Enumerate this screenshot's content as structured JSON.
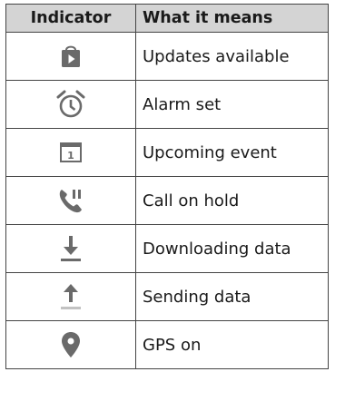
{
  "table": {
    "headers": [
      "Indicator",
      "What it means"
    ],
    "rows": [
      {
        "icon": "play-store-update-icon",
        "text": "Updates available"
      },
      {
        "icon": "alarm-clock-icon",
        "text": "Alarm set"
      },
      {
        "icon": "calendar-event-icon",
        "text": "Upcoming event"
      },
      {
        "icon": "phone-hold-icon",
        "text": "Call on hold"
      },
      {
        "icon": "download-arrow-icon",
        "text": "Downloading data"
      },
      {
        "icon": "upload-arrow-icon",
        "text": "Sending data"
      },
      {
        "icon": "location-pin-icon",
        "text": "GPS on"
      }
    ]
  },
  "colors": {
    "header_bg": "#d4d4d4",
    "icon_gray": "#6a6a6a",
    "border": "#444444"
  }
}
